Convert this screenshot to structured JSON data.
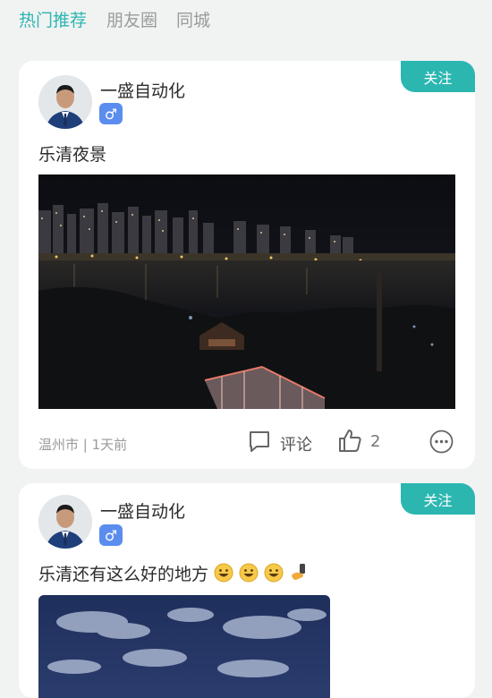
{
  "tabs": [
    {
      "label": "热门推荐",
      "active": true
    },
    {
      "label": "朋友圈",
      "active": false
    },
    {
      "label": "同城",
      "active": false
    }
  ],
  "colors": {
    "accent": "#2bb6b0",
    "gender_badge": "#5b8def"
  },
  "posts": [
    {
      "follow_label": "关注",
      "username": "一盛自动化",
      "gender_icon": "male-icon",
      "gender_glyph": "♂",
      "text": "乐清夜景",
      "image": "city-night-river-photo",
      "location_time": "温州市 | 1天前",
      "comment_label": "评论",
      "like_count": "2"
    },
    {
      "follow_label": "关注",
      "username": "一盛自动化",
      "gender_icon": "male-icon",
      "gender_glyph": "♂",
      "text": "乐清还有这么好的地方",
      "emojis": [
        "grinning-face-emoji",
        "grinning-face-emoji",
        "grinning-face-emoji",
        "selfie-emoji"
      ],
      "image": "night-sky-clouds-photo"
    }
  ]
}
